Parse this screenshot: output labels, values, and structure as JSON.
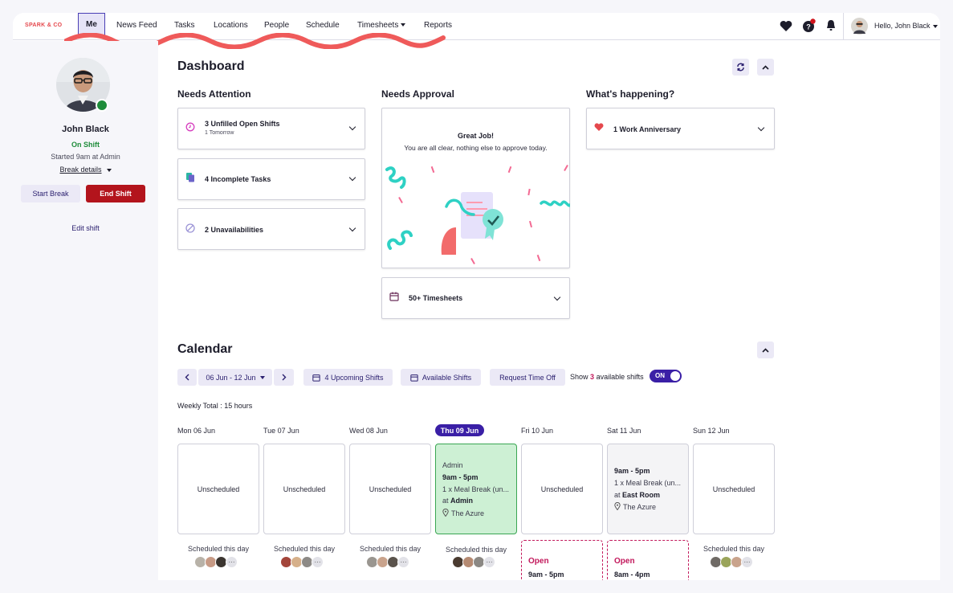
{
  "brand": "SPARK & CO",
  "nav": {
    "items": [
      {
        "label": "Me"
      },
      {
        "label": "News Feed"
      },
      {
        "label": "Tasks"
      },
      {
        "label": "Locations"
      },
      {
        "label": "People"
      },
      {
        "label": "Schedule"
      },
      {
        "label": "Timesheets"
      },
      {
        "label": "Reports"
      }
    ],
    "greeting": "Hello, John Black"
  },
  "sidebar": {
    "name": "John Black",
    "status": "On Shift",
    "started": "Started 9am at Admin",
    "break_details": "Break details",
    "start_break": "Start Break",
    "end_shift": "End Shift",
    "edit_shift": "Edit shift"
  },
  "dashboard": {
    "title": "Dashboard",
    "needs_attention": {
      "title": "Needs Attention",
      "cards": [
        {
          "label": "3 Unfilled Open Shifts",
          "sub": "1 Tomorrow",
          "icon": "clock-icon"
        },
        {
          "label": "4 Incomplete Tasks",
          "icon": "clipboard-icon"
        },
        {
          "label": "2 Unavailabilities",
          "icon": "ban-icon"
        }
      ]
    },
    "needs_approval": {
      "title": "Needs Approval",
      "great_job": "Great Job!",
      "all_clear": "You are all clear, nothing else to approve today.",
      "timesheets": "50+ Timesheets"
    },
    "whats_happening": {
      "title": "What's happening?",
      "anniversary": "1 Work Anniversary"
    }
  },
  "calendar": {
    "title": "Calendar",
    "range": "06 Jun - 12 Jun",
    "upcoming": "4 Upcoming Shifts",
    "available": "Available Shifts",
    "request_off": "Request Time Off",
    "show_prefix": "Show",
    "show_count": "3",
    "show_suffix": "available shifts",
    "toggle": "ON",
    "weekly_total": "Weekly Total : 15 hours",
    "days": [
      {
        "label": "Mon 06 Jun",
        "text": "Unscheduled",
        "scheduled": "Scheduled this day"
      },
      {
        "label": "Tue 07 Jun",
        "text": "Unscheduled",
        "scheduled": "Scheduled this day"
      },
      {
        "label": "Wed 08 Jun",
        "text": "Unscheduled",
        "scheduled": "Scheduled this day"
      },
      {
        "label": "Thu 09 Jun",
        "role": "Admin",
        "time": "9am - 5pm",
        "break": "1 x Meal Break (un...",
        "at": "at",
        "where": "Admin",
        "location": "The Azure",
        "scheduled": "Scheduled this day"
      },
      {
        "label": "Fri 10 Jun",
        "text": "Unscheduled",
        "open": "Open",
        "open_time": "9am - 5pm"
      },
      {
        "label": "Sat 11 Jun",
        "time": "9am - 5pm",
        "break": "1 x Meal Break (un...",
        "at": "at",
        "where": "East Room",
        "location": "The Azure",
        "open": "Open",
        "open_time": "8am - 4pm"
      },
      {
        "label": "Sun 12 Jun",
        "text": "Unscheduled",
        "scheduled": "Scheduled this day"
      }
    ],
    "more": "···"
  },
  "colors": {
    "accent": "#3a1fa6",
    "danger": "#b3141c",
    "success": "#1e8c3a",
    "brand": "#e5484d",
    "open": "#c2185b"
  }
}
